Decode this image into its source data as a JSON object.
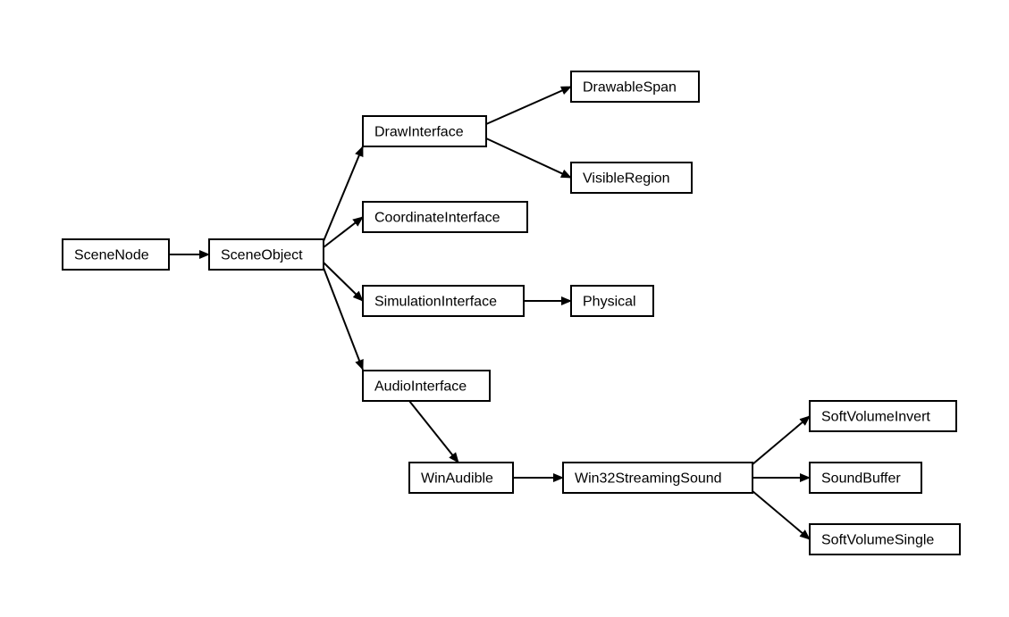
{
  "diagram": {
    "nodes": [
      {
        "id": "SceneNode",
        "label": "SceneNode"
      },
      {
        "id": "SceneObject",
        "label": "SceneObject"
      },
      {
        "id": "DrawInterface",
        "label": "DrawInterface"
      },
      {
        "id": "CoordinateInterface",
        "label": "CoordinateInterface"
      },
      {
        "id": "SimulationInterface",
        "label": "SimulationInterface"
      },
      {
        "id": "AudioInterface",
        "label": "AudioInterface"
      },
      {
        "id": "DrawableSpan",
        "label": "DrawableSpan"
      },
      {
        "id": "VisibleRegion",
        "label": "VisibleRegion"
      },
      {
        "id": "Physical",
        "label": "Physical"
      },
      {
        "id": "WinAudible",
        "label": "WinAudible"
      },
      {
        "id": "Win32StreamingSound",
        "label": "Win32StreamingSound"
      },
      {
        "id": "SoftVolumeInvert",
        "label": "SoftVolumeInvert"
      },
      {
        "id": "SoundBuffer",
        "label": "SoundBuffer"
      },
      {
        "id": "SoftVolumeSingle",
        "label": "SoftVolumeSingle"
      }
    ],
    "edges": [
      {
        "from": "SceneNode",
        "to": "SceneObject"
      },
      {
        "from": "SceneObject",
        "to": "DrawInterface"
      },
      {
        "from": "SceneObject",
        "to": "CoordinateInterface"
      },
      {
        "from": "SceneObject",
        "to": "SimulationInterface"
      },
      {
        "from": "SceneObject",
        "to": "AudioInterface"
      },
      {
        "from": "DrawInterface",
        "to": "DrawableSpan"
      },
      {
        "from": "DrawInterface",
        "to": "VisibleRegion"
      },
      {
        "from": "SimulationInterface",
        "to": "Physical"
      },
      {
        "from": "AudioInterface",
        "to": "WinAudible"
      },
      {
        "from": "WinAudible",
        "to": "Win32StreamingSound"
      },
      {
        "from": "Win32StreamingSound",
        "to": "SoftVolumeInvert"
      },
      {
        "from": "Win32StreamingSound",
        "to": "SoundBuffer"
      },
      {
        "from": "Win32StreamingSound",
        "to": "SoftVolumeSingle"
      }
    ]
  }
}
